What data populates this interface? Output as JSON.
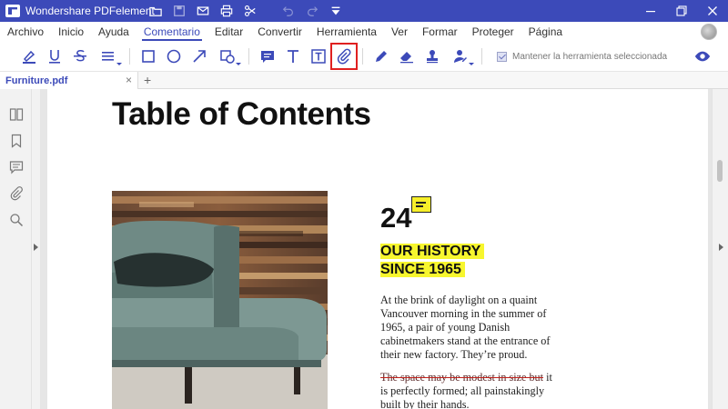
{
  "window": {
    "title": "Wondershare PDFelement",
    "quick_icons": [
      "folder-icon",
      "save-icon",
      "mail-icon",
      "print-icon",
      "scissors-icon",
      "undo-icon",
      "redo-icon",
      "dropdown-icon"
    ],
    "controls": [
      "minimize-icon",
      "maximize-icon",
      "close-icon"
    ]
  },
  "menu": {
    "items": [
      "Archivo",
      "Inicio",
      "Ayuda",
      "Comentario",
      "Editar",
      "Convertir",
      "Herramienta",
      "Ver",
      "Formar",
      "Proteger",
      "Página"
    ],
    "active": "Comentario"
  },
  "toolbar": {
    "tools": [
      "highlight-icon",
      "underline-icon",
      "strikethrough-icon",
      "lines-icon",
      "rectangle-icon",
      "ellipse-icon",
      "arrow-icon",
      "shapes-icon",
      "sticky-note-icon",
      "text-icon",
      "textbox-icon",
      "attachment-icon",
      "pencil-icon",
      "eraser-icon",
      "stamp-icon",
      "signature-icon"
    ],
    "selected_tool": "attachment-icon",
    "keep_tool_label": "Mantener la herramienta seleccionada",
    "keep_tool_checked": true
  },
  "tabs": {
    "file_name": "Furniture.pdf",
    "close_label": "×",
    "add_label": "+"
  },
  "sidebar": {
    "icons": [
      "thumbnails-icon",
      "bookmark-icon",
      "comments-icon",
      "attachments-icon",
      "search-icon"
    ]
  },
  "document": {
    "heading": "Table of Contents",
    "page_number": "24",
    "history_line1": "OUR HISTORY",
    "history_line2": "SINCE 1965",
    "paragraph1": "At the brink of daylight on a quaint Vancouver morning in the summer of 1965, a pair of young Danish cabinetmakers stand at the entrance of their new factory. They’re proud.",
    "paragraph2_struck": "The space may be modest in size but",
    "paragraph2_rest": " it is perfectly formed; all painstakingly built by their hands.",
    "highlight_color": "#f7f62e",
    "strike_color": "#c0201a"
  },
  "colors": {
    "brand": "#3c4ab9",
    "selection_box": "#e02020"
  }
}
